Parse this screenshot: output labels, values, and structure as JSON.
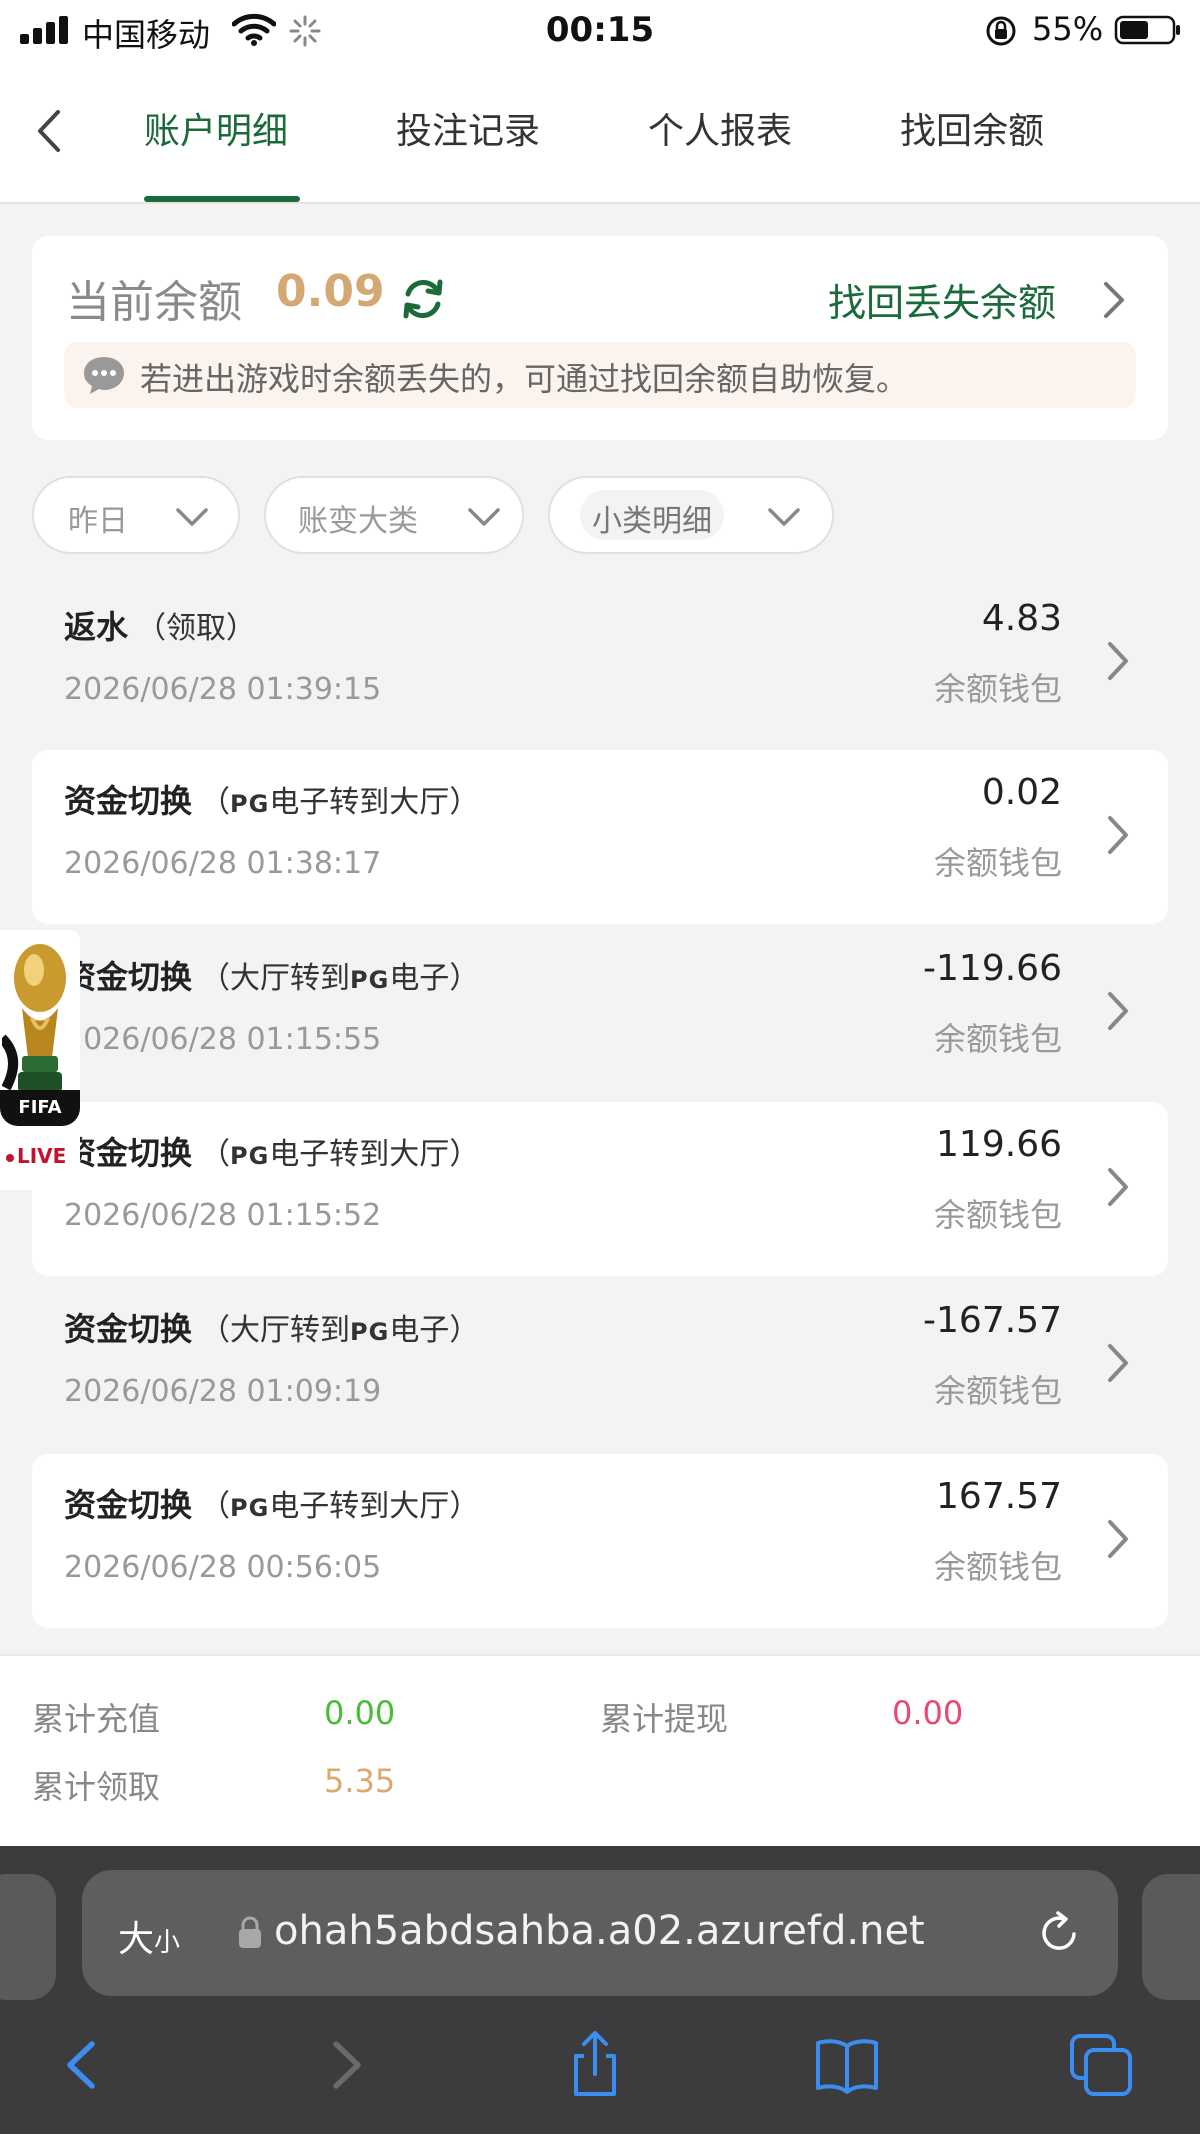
{
  "status_bar": {
    "carrier": "中国移动",
    "time": "00:15",
    "battery_pct": "55%"
  },
  "nav": {
    "tabs": [
      {
        "label": "账户明细",
        "active": true
      },
      {
        "label": "投注记录",
        "active": false
      },
      {
        "label": "个人报表",
        "active": false
      },
      {
        "label": "找回余额",
        "active": false
      }
    ]
  },
  "balance": {
    "label": "当前余额",
    "value": "0.09",
    "recover_link": "找回丢失余额",
    "notice": "若进出游戏时余额丢失的，可通过找回余额自助恢复。"
  },
  "filters": {
    "date": "昨日",
    "category": "账变大类",
    "subcategory": "小类明细"
  },
  "records": [
    {
      "title": "返水",
      "paren_open": "（",
      "sub_pre": "领取",
      "pg": "",
      "sub_post": "",
      "paren_close": "）",
      "date": "2026/06/28 01:39:15",
      "amount": "4.83",
      "wallet": "余额钱包"
    },
    {
      "title": "资金切换",
      "paren_open": "（",
      "sub_pre": "",
      "pg": "PG",
      "sub_post": "电子转到大厅",
      "paren_close": "）",
      "date": "2026/06/28 01:38:17",
      "amount": "0.02",
      "wallet": "余额钱包"
    },
    {
      "title": "资金切换",
      "paren_open": "（",
      "sub_pre": "大厅转到",
      "pg": "PG",
      "sub_post": "电子",
      "paren_close": "）",
      "date": "2026/06/28 01:15:55",
      "amount": "-119.66",
      "wallet": "余额钱包"
    },
    {
      "title": "资金切换",
      "paren_open": "（",
      "sub_pre": "",
      "pg": "PG",
      "sub_post": "电子转到大厅",
      "paren_close": "）",
      "date": "2026/06/28 01:15:52",
      "amount": "119.66",
      "wallet": "余额钱包"
    },
    {
      "title": "资金切换",
      "paren_open": "（",
      "sub_pre": "大厅转到",
      "pg": "PG",
      "sub_post": "电子",
      "paren_close": "）",
      "date": "2026/06/28 01:09:19",
      "amount": "-167.57",
      "wallet": "余额钱包"
    },
    {
      "title": "资金切换",
      "paren_open": "（",
      "sub_pre": "",
      "pg": "PG",
      "sub_post": "电子转到大厅",
      "paren_close": "）",
      "date": "2026/06/28 00:56:05",
      "amount": "167.57",
      "wallet": "余额钱包"
    }
  ],
  "badge": {
    "fifa": "FIFA",
    "live": "LIVE"
  },
  "summary": {
    "deposit_label": "累计充值",
    "deposit_value": "0.00",
    "withdraw_label": "累计提现",
    "withdraw_value": "0.00",
    "claim_label": "累计领取",
    "claim_value": "5.35"
  },
  "browser": {
    "text_size": "大",
    "text_size_small": "小",
    "url": "ohah5abdsahba.a02.azurefd.net"
  },
  "colors": {
    "brand_green": "#1b6b3a",
    "gold": "#d4a873",
    "deposit_green": "#4cbb3c",
    "withdraw_pink": "#e84a6f",
    "claim_gold": "#d9a96e"
  },
  "icons": [
    "back-icon",
    "refresh-icon",
    "chevron-right-icon",
    "chat-icon",
    "chevron-down-icon",
    "trophy-icon",
    "lock-icon",
    "reload-icon",
    "share-icon",
    "bookmarks-icon",
    "tabs-icon"
  ]
}
